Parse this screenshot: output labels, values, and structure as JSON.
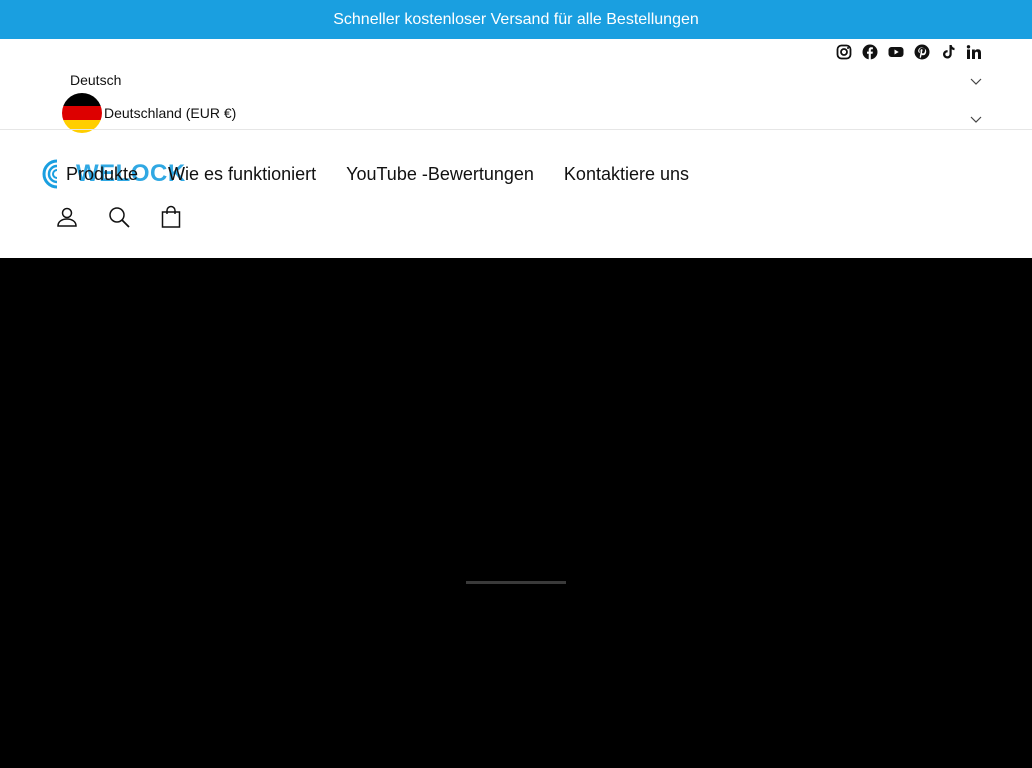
{
  "announcement": {
    "text": "Schneller kostenloser Versand für alle Bestellungen"
  },
  "social": {
    "icons": [
      "instagram-icon",
      "facebook-icon",
      "youtube-icon",
      "pinterest-icon",
      "tiktok-icon",
      "linkedin-icon"
    ]
  },
  "language": {
    "selected": "Deutsch"
  },
  "country": {
    "selected": "Deutschland (EUR €)",
    "flag": [
      "#000000",
      "#dd0000",
      "#ffce00"
    ]
  },
  "brand": {
    "wordmark": "WELOCK",
    "color": "#1a9fe0"
  },
  "nav": {
    "items": [
      {
        "label": "Produkte"
      },
      {
        "label": "Wie es funktioniert"
      },
      {
        "label": "YouTube -Bewertungen"
      },
      {
        "label": "Kontaktiere uns"
      }
    ]
  },
  "utility": {
    "icons": [
      "account-icon",
      "search-icon",
      "cart-icon"
    ]
  },
  "colors": {
    "accent": "#1a9fe0",
    "content_bg": "#000000"
  }
}
